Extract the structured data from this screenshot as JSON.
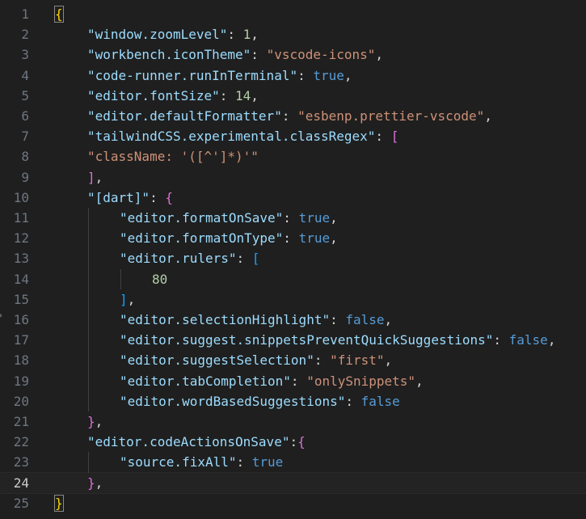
{
  "editor": {
    "active_line": 24,
    "colors": {
      "background": "#1f1f1f",
      "line_number": "#6e7681",
      "key": "#9cdcfe",
      "string": "#ce9178",
      "number": "#b5cea8",
      "boolean": "#569cd6",
      "bracket_level_1": "#ffd700",
      "bracket_level_2": "#da70d6",
      "bracket_level_3": "#179fff"
    },
    "lines": [
      {
        "n": "1",
        "indent": 0,
        "tokens": [
          {
            "t": "{",
            "c": "brk1-match"
          }
        ]
      },
      {
        "n": "2",
        "indent": 1,
        "tokens": [
          {
            "t": "\"window.zoomLevel\"",
            "c": "key"
          },
          {
            "t": ": ",
            "c": "punc"
          },
          {
            "t": "1",
            "c": "num"
          },
          {
            "t": ",",
            "c": "punc"
          }
        ]
      },
      {
        "n": "3",
        "indent": 1,
        "tokens": [
          {
            "t": "\"workbench.iconTheme\"",
            "c": "key"
          },
          {
            "t": ": ",
            "c": "punc"
          },
          {
            "t": "\"vscode-icons\"",
            "c": "str"
          },
          {
            "t": ",",
            "c": "punc"
          }
        ]
      },
      {
        "n": "4",
        "indent": 1,
        "tokens": [
          {
            "t": "\"code-runner.runInTerminal\"",
            "c": "key"
          },
          {
            "t": ": ",
            "c": "punc"
          },
          {
            "t": "true",
            "c": "bool"
          },
          {
            "t": ",",
            "c": "punc"
          }
        ]
      },
      {
        "n": "5",
        "indent": 1,
        "tokens": [
          {
            "t": "\"editor.fontSize\"",
            "c": "key"
          },
          {
            "t": ": ",
            "c": "punc"
          },
          {
            "t": "14",
            "c": "num"
          },
          {
            "t": ",",
            "c": "punc"
          }
        ]
      },
      {
        "n": "6",
        "indent": 1,
        "tokens": [
          {
            "t": "\"editor.defaultFormatter\"",
            "c": "key"
          },
          {
            "t": ": ",
            "c": "punc"
          },
          {
            "t": "\"esbenp.prettier-vscode\"",
            "c": "str"
          },
          {
            "t": ",",
            "c": "punc"
          }
        ]
      },
      {
        "n": "7",
        "indent": 1,
        "tokens": [
          {
            "t": "\"tailwindCSS.experimental.classRegex\"",
            "c": "key"
          },
          {
            "t": ": ",
            "c": "punc"
          },
          {
            "t": "[",
            "c": "brk2"
          }
        ]
      },
      {
        "n": "8",
        "indent": 1,
        "tokens": [
          {
            "t": "\"className: '([^']*)'\"",
            "c": "str"
          }
        ]
      },
      {
        "n": "9",
        "indent": 1,
        "tokens": [
          {
            "t": "]",
            "c": "brk2"
          },
          {
            "t": ",",
            "c": "punc"
          }
        ]
      },
      {
        "n": "10",
        "indent": 1,
        "tokens": [
          {
            "t": "\"[dart]\"",
            "c": "key"
          },
          {
            "t": ": ",
            "c": "punc"
          },
          {
            "t": "{",
            "c": "brk2"
          }
        ]
      },
      {
        "n": "11",
        "indent": 2,
        "tokens": [
          {
            "t": "\"editor.formatOnSave\"",
            "c": "key"
          },
          {
            "t": ": ",
            "c": "punc"
          },
          {
            "t": "true",
            "c": "bool"
          },
          {
            "t": ",",
            "c": "punc"
          }
        ]
      },
      {
        "n": "12",
        "indent": 2,
        "tokens": [
          {
            "t": "\"editor.formatOnType\"",
            "c": "key"
          },
          {
            "t": ": ",
            "c": "punc"
          },
          {
            "t": "true",
            "c": "bool"
          },
          {
            "t": ",",
            "c": "punc"
          }
        ]
      },
      {
        "n": "13",
        "indent": 2,
        "tokens": [
          {
            "t": "\"editor.rulers\"",
            "c": "key"
          },
          {
            "t": ": ",
            "c": "punc"
          },
          {
            "t": "[",
            "c": "brk3"
          }
        ]
      },
      {
        "n": "14",
        "indent": 3,
        "tokens": [
          {
            "t": "80",
            "c": "num"
          }
        ]
      },
      {
        "n": "15",
        "indent": 2,
        "tokens": [
          {
            "t": "]",
            "c": "brk3"
          },
          {
            "t": ",",
            "c": "punc"
          }
        ]
      },
      {
        "n": "16",
        "indent": 2,
        "tokens": [
          {
            "t": "\"editor.selectionHighlight\"",
            "c": "key"
          },
          {
            "t": ": ",
            "c": "punc"
          },
          {
            "t": "false",
            "c": "bool"
          },
          {
            "t": ",",
            "c": "punc"
          }
        ]
      },
      {
        "n": "17",
        "indent": 2,
        "tokens": [
          {
            "t": "\"editor.suggest.snippetsPreventQuickSuggestions\"",
            "c": "key"
          },
          {
            "t": ": ",
            "c": "punc"
          },
          {
            "t": "false",
            "c": "bool"
          },
          {
            "t": ",",
            "c": "punc"
          }
        ]
      },
      {
        "n": "18",
        "indent": 2,
        "tokens": [
          {
            "t": "\"editor.suggestSelection\"",
            "c": "key"
          },
          {
            "t": ": ",
            "c": "punc"
          },
          {
            "t": "\"first\"",
            "c": "str"
          },
          {
            "t": ",",
            "c": "punc"
          }
        ]
      },
      {
        "n": "19",
        "indent": 2,
        "tokens": [
          {
            "t": "\"editor.tabCompletion\"",
            "c": "key"
          },
          {
            "t": ": ",
            "c": "punc"
          },
          {
            "t": "\"onlySnippets\"",
            "c": "str"
          },
          {
            "t": ",",
            "c": "punc"
          }
        ]
      },
      {
        "n": "20",
        "indent": 2,
        "tokens": [
          {
            "t": "\"editor.wordBasedSuggestions\"",
            "c": "key"
          },
          {
            "t": ": ",
            "c": "punc"
          },
          {
            "t": "false",
            "c": "bool"
          }
        ]
      },
      {
        "n": "21",
        "indent": 1,
        "tokens": [
          {
            "t": "}",
            "c": "brk2"
          },
          {
            "t": ",",
            "c": "punc"
          }
        ]
      },
      {
        "n": "22",
        "indent": 1,
        "tokens": [
          {
            "t": "\"editor.codeActionsOnSave\"",
            "c": "key"
          },
          {
            "t": ":",
            "c": "punc"
          },
          {
            "t": "{",
            "c": "brk2"
          }
        ]
      },
      {
        "n": "23",
        "indent": 2,
        "tokens": [
          {
            "t": "\"source.fixAll\"",
            "c": "key"
          },
          {
            "t": ": ",
            "c": "punc"
          },
          {
            "t": "true",
            "c": "bool"
          }
        ]
      },
      {
        "n": "24",
        "indent": 1,
        "tokens": [
          {
            "t": "}",
            "c": "brk2"
          },
          {
            "t": ",",
            "c": "punc"
          }
        ]
      },
      {
        "n": "25",
        "indent": 0,
        "tokens": [
          {
            "t": "}",
            "c": "brk1-match"
          }
        ]
      }
    ],
    "guides": [
      {
        "from": 13,
        "to": 15,
        "level": 2
      },
      {
        "from": 10,
        "to": 21,
        "level": 1
      },
      {
        "from": 22,
        "to": 24,
        "level": 1
      }
    ],
    "fold_icon": "chevron-right-icon"
  }
}
